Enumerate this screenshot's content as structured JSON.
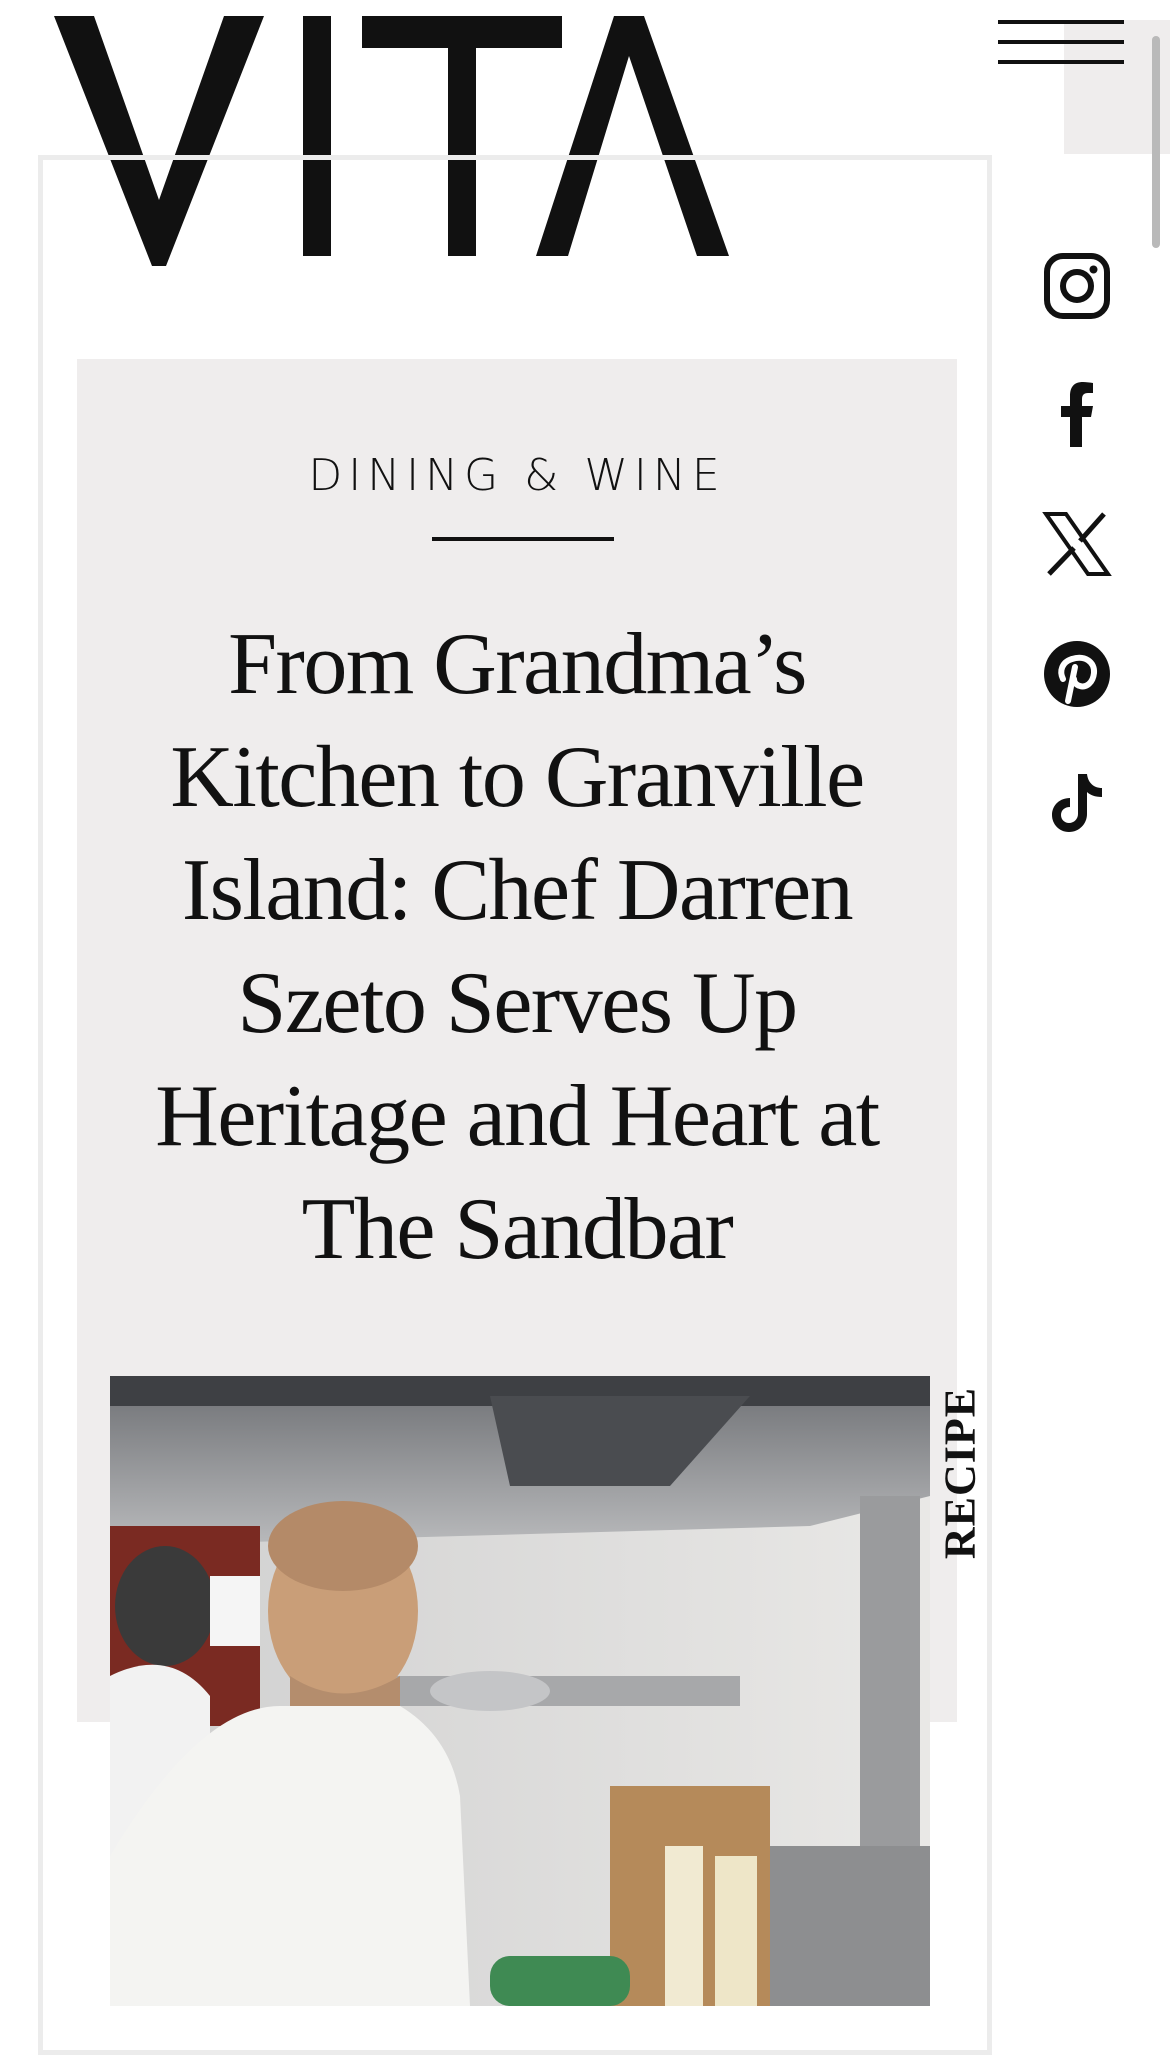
{
  "brand": {
    "name": "VITA"
  },
  "header": {
    "menu_icon": "hamburger-menu-icon"
  },
  "article": {
    "category": "DINING & WINE",
    "title": "From Grandma’s Kitchen to Granville Island: Chef Darren Szeto Serves Up Heritage and Heart at The Sandbar",
    "tag": "RECIPE",
    "image_subject": "Chef in white chef's jacket smiling in a stainless steel restaurant kitchen"
  },
  "social": [
    {
      "name": "instagram",
      "icon": "instagram-icon"
    },
    {
      "name": "facebook",
      "icon": "facebook-icon"
    },
    {
      "name": "x",
      "icon": "x-icon"
    },
    {
      "name": "pinterest",
      "icon": "pinterest-icon"
    },
    {
      "name": "tiktok",
      "icon": "tiktok-icon"
    }
  ],
  "colors": {
    "panel": "#efeded",
    "text": "#111111",
    "frame": "#ececec"
  }
}
